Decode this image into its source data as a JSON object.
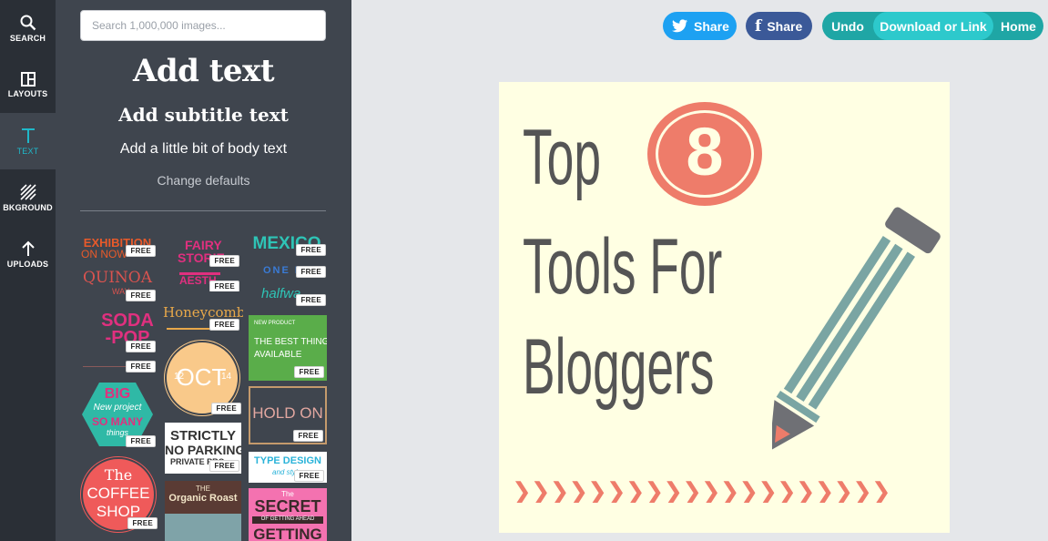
{
  "sidebar": {
    "items": [
      {
        "label": "SEARCH",
        "icon": "search-icon"
      },
      {
        "label": "LAYOUTS",
        "icon": "layouts-icon"
      },
      {
        "label": "TEXT",
        "icon": "text-icon",
        "active": true
      },
      {
        "label": "BKGROUND",
        "icon": "background-icon"
      },
      {
        "label": "UPLOADS",
        "icon": "upload-icon"
      }
    ]
  },
  "panel": {
    "search_placeholder": "Search 1,000,000 images...",
    "add_heading": "Add text",
    "add_subtitle": "Add subtitle text",
    "add_body": "Add a little bit of body text",
    "change_defaults": "Change defaults",
    "free_label": "FREE",
    "tiles": {
      "exhibition": "EXHIBITION",
      "on_now": "ON NOW",
      "quinoa": "QUINOA",
      "way": "WAY",
      "soda": "SODA",
      "pop": "-POP",
      "big": "BIG",
      "new_project": "New project",
      "so_many": "SO MANY",
      "things": "things",
      "the_1": "The",
      "coffee": "COFFEE",
      "shop": "SHOP",
      "fairy": "FAIRY",
      "stories": "STORIE",
      "aesth": "AESTH",
      "honeycomb": "Honeycomb",
      "oct": "OCT",
      "oct_left": "12",
      "oct_right": "14",
      "strictly": "STRICTLY",
      "no_parking": "NO PARKING",
      "private_pro": "PRIVATE PRO",
      "the_2": "THE",
      "organic_roast": "Organic Roast",
      "mexico": "MEXICO",
      "one_d": "ONE D",
      "halfway": "halfwa",
      "new_product": "NEW PRODUCT",
      "best_thing": "THE BEST THING",
      "available": "AVAILABLE",
      "hold_on": "HOLD ON",
      "type_design": "TYPE DESIGN",
      "and_style": "and style",
      "the_3": "The",
      "secret": "SECRET",
      "getting_ahead": "OF GETTING AHEAD",
      "getting": "GETTING"
    }
  },
  "header": {
    "twitter_share": "Share",
    "facebook_share": "Share",
    "undo": "Undo",
    "download": "Download or Link",
    "home": "Home"
  },
  "canvas": {
    "line1": "Top",
    "number": "8",
    "line2": "Tools For",
    "line3": "Bloggers",
    "chevrons": "❯❯❯❯❯❯❯❯❯❯❯❯❯❯❯❯❯❯❯❯",
    "colors": {
      "background": "#ffffe3",
      "text": "#555555",
      "accent": "#ee7c6a",
      "pencil": "#7aa5a3"
    }
  },
  "colors": {
    "rail": "#2a2f36",
    "panel": "#3f454e",
    "active": "#1fb8c9",
    "twitter": "#1da1f2",
    "facebook": "#3b5998",
    "teal": "#1fa6a5",
    "teal_light": "#2dc9cc"
  }
}
